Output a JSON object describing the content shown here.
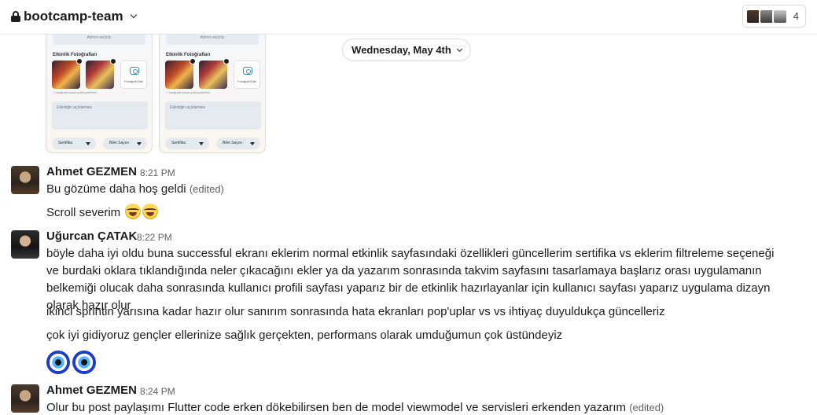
{
  "header": {
    "channel_name": "bootcamp-team",
    "member_count": "4"
  },
  "previews": [
    {
      "address_placeholder": "Adresi seçiniz",
      "photos_label": "Etkinlik Fotoğrafları",
      "add_photo": "Fotoğraf Ekle",
      "hint": "7 fotoğrafa kadar yükleyebilirsin",
      "description_placeholder": "Etkinliğin açıklaması",
      "dropdown_1": "Sertifika",
      "dropdown_2": "Bilet Sayısı"
    },
    {
      "address_placeholder": "Adresi seçiniz",
      "photos_label": "Etkinlik Fotoğrafları",
      "add_photo": "Fotoğraf Ekle",
      "hint": "7 fotoğrafa kadar yükleyebilirsin",
      "description_placeholder": "Etkinliğin açıklaması",
      "dropdown_1": "Sertifika",
      "dropdown_2": "Bilet Sayısı"
    }
  ],
  "date_divider": "Wednesday, May 4th",
  "messages": [
    {
      "author": "Ahmet GEZMEN",
      "time": "8:21 PM",
      "lines": [
        "Bu gözüme daha hoş geldi",
        "Scroll severim"
      ],
      "edited": "(edited)",
      "emojis": [
        "joy-emoji",
        "joy-emoji"
      ]
    },
    {
      "author": "Uğurcan ÇATAK",
      "time": "8:22 PM",
      "paragraphs": [
        "böyle daha iyi oldu buna successful ekranı eklerim normal etkinlik sayfasındaki özellikleri güncellerim sertifika vs eklerim filtreleme seçeneği ve burdaki oklara tıklandığında neler çıkacağını ekler ya da yazarım sonrasında takvim sayfasını tasarlamaya başlarız orası uygulamanın belkemiği olucak daha sonrasında kullanıcı profili sayfası yaparız bir de etkinlik hazırlayanlar için kullanıcı sayfası yaparız uygulama dizayn olarak hazır olur",
        "ikinci sprintin yarısına kadar hazır olur sanırım sonrasında hata ekranları pop'uplar vs vs ihtiyaç duyuldukça güncelleriz",
        "çok iyi gidiyoruz gençler ellerinize sağlık gerçekten, performans olarak umduğumun çok üstündeyiz"
      ],
      "emojis": [
        "nazar-amulet-emoji",
        "nazar-amulet-emoji"
      ]
    },
    {
      "author": "Ahmet GEZMEN",
      "time": "8:24 PM",
      "lines": [
        "Olur bu post paylaşımı Flutter code erken dökebilirsen ben de model viewmodel ve servisleri erkenden yazarım"
      ],
      "edited": "(edited)"
    }
  ]
}
